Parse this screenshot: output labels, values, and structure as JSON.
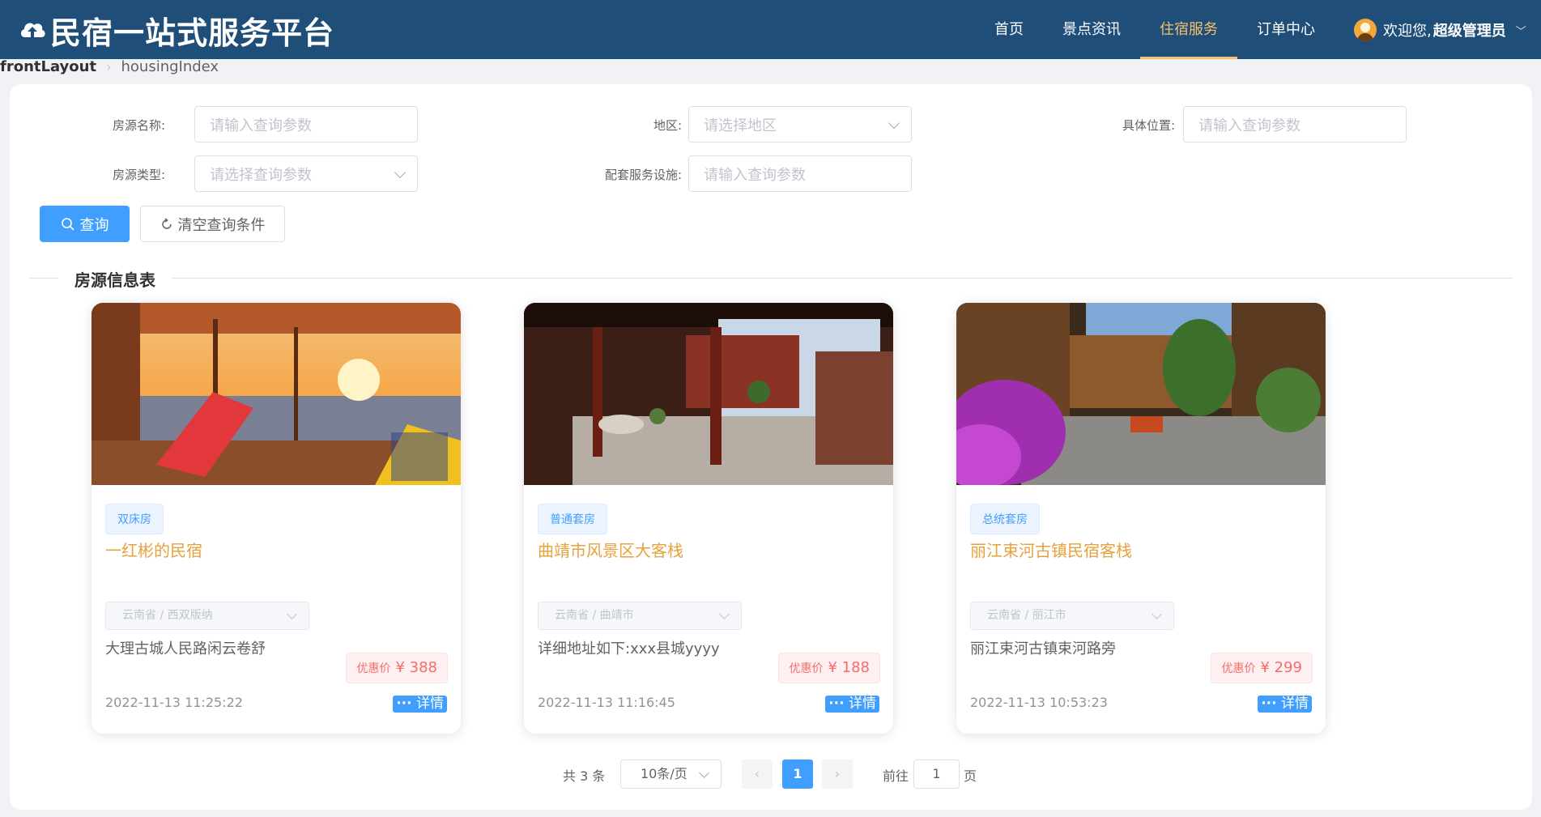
{
  "header": {
    "title": "民宿一站式服务平台",
    "nav": [
      {
        "label": "首页",
        "active": false
      },
      {
        "label": "景点资讯",
        "active": false
      },
      {
        "label": "住宿服务",
        "active": true
      },
      {
        "label": "订单中心",
        "active": false
      }
    ],
    "user": {
      "greeting": "欢迎您,",
      "name": "超级管理员"
    },
    "colors": {
      "background": "#1f4e79",
      "active": "#f5c26b"
    }
  },
  "breadcrumb": [
    "frontLayout",
    "housingIndex"
  ],
  "search": {
    "fields": [
      {
        "label": "房源名称:",
        "placeholder": "请输入查询参数",
        "type": "input"
      },
      {
        "label": "地区:",
        "placeholder": "请选择地区",
        "type": "select"
      },
      {
        "label": "具体位置:",
        "placeholder": "请输入查询参数",
        "type": "input"
      },
      {
        "label": "房源类型:",
        "placeholder": "请选择查询参数",
        "type": "select"
      },
      {
        "label": "配套服务设施:",
        "placeholder": "请输入查询参数",
        "type": "input"
      }
    ],
    "query_button": "查询",
    "reset_button": "清空查询条件"
  },
  "section_title": "房源信息表",
  "listings": [
    {
      "tag": "双床房",
      "name": "一红彬的民宿",
      "region": "云南省 / 西双版纳",
      "address": "大理古城人民路闲云卷舒",
      "price_label": "优惠价",
      "price": "¥ 388",
      "date": "2022-11-13 11:25:22",
      "detail": "详情"
    },
    {
      "tag": "普通套房",
      "name": "曲靖市风景区大客栈",
      "region": "云南省 / 曲靖市",
      "address": "详细地址如下:xxx县城yyyy",
      "price_label": "优惠价",
      "price": "¥ 188",
      "date": "2022-11-13 11:16:45",
      "detail": "详情"
    },
    {
      "tag": "总统套房",
      "name": "丽江束河古镇民宿客栈",
      "region": "云南省 / 丽江市",
      "address": "丽江束河古镇束河路旁",
      "price_label": "优惠价",
      "price": "¥ 299",
      "date": "2022-11-13 10:53:23",
      "detail": "详情"
    }
  ],
  "pagination": {
    "total": "共 3 条",
    "page_size": "10条/页",
    "current_page": "1",
    "goto_label": "前往",
    "goto_value": "1",
    "page_suffix": "页"
  }
}
